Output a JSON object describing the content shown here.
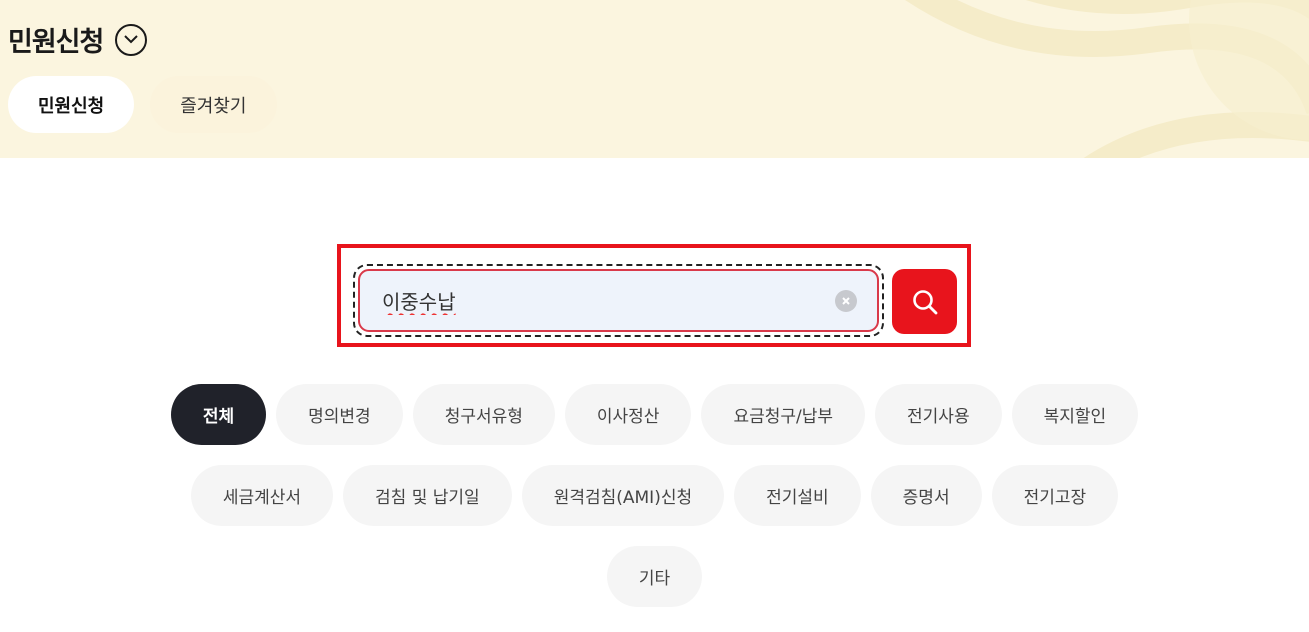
{
  "header": {
    "title": "민원신청",
    "tabs": [
      {
        "label": "민원신청",
        "active": true
      },
      {
        "label": "즐겨찾기",
        "active": false
      }
    ]
  },
  "search": {
    "value": "이중수납",
    "placeholder": "",
    "clear_icon": "clear-icon",
    "search_icon": "search-icon"
  },
  "categories": {
    "row1": [
      "전체",
      "명의변경",
      "청구서유형",
      "이사정산",
      "요금청구/납부",
      "전기사용",
      "복지할인"
    ],
    "row2": [
      "세금계산서",
      "검침 및 납기일",
      "원격검침(AMI)신청",
      "전기설비",
      "증명서",
      "전기고장"
    ],
    "row3": [
      "기타"
    ],
    "active": "전체"
  },
  "colors": {
    "accent": "#e8141c",
    "header_bg": "#fbf5df",
    "active_chip": "#20222a"
  }
}
